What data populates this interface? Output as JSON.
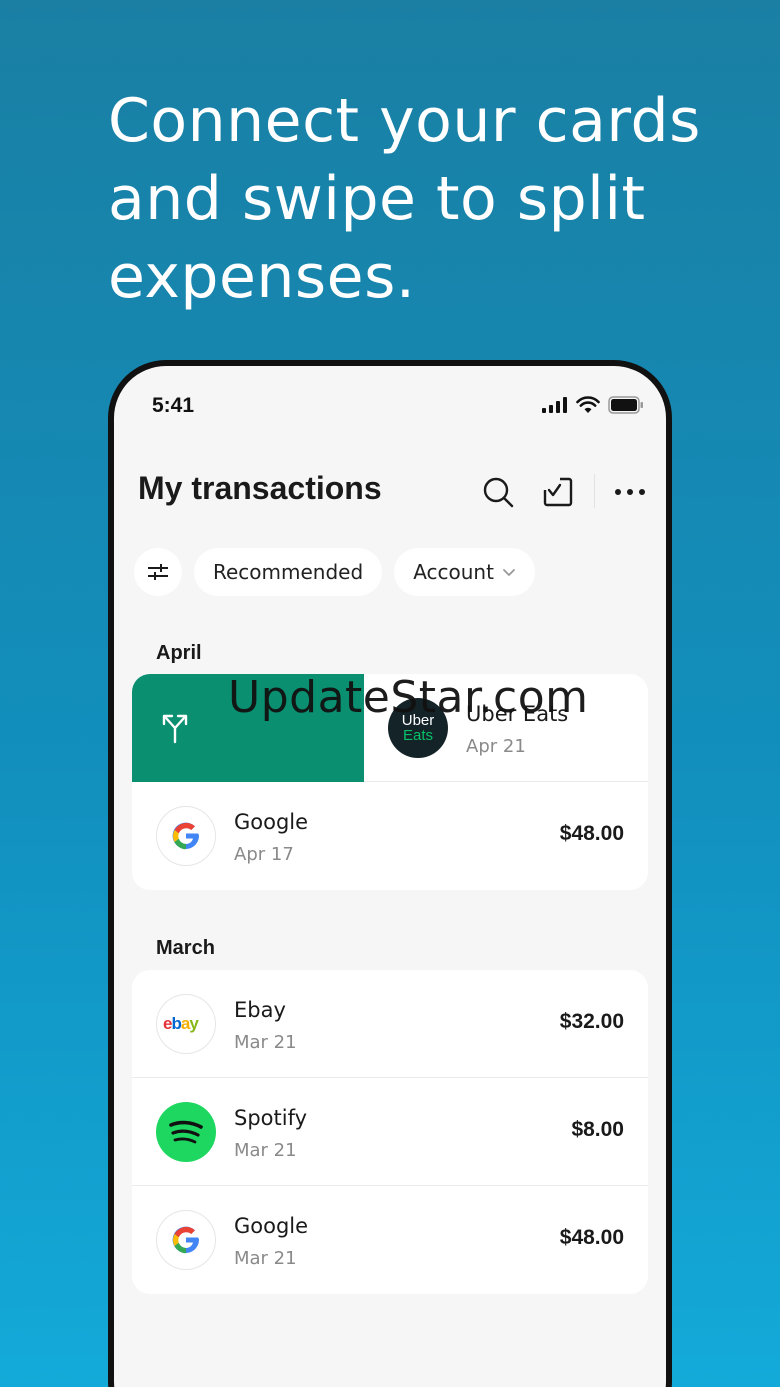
{
  "headline": {
    "line1": "Connect your cards",
    "line2": "and swipe to split",
    "line3": "expenses."
  },
  "status_bar": {
    "time": "5:41"
  },
  "header": {
    "title": "My transactions",
    "icons": [
      "search-icon",
      "check-square-icon",
      "more-icon"
    ]
  },
  "filters": {
    "recommended_label": "Recommended",
    "account_label": "Account"
  },
  "sections": [
    {
      "month": "April",
      "transactions": [
        {
          "merchant": "Uber Eats",
          "date": "Apr 21",
          "amount": "",
          "logo": "uber-eats-logo",
          "logo_text_1": "Uber",
          "logo_text_2": "Eats",
          "swiped": true
        },
        {
          "merchant": "Google",
          "date": "Apr 17",
          "amount": "$48.00",
          "logo": "google-logo"
        }
      ]
    },
    {
      "month": "March",
      "transactions": [
        {
          "merchant": "Ebay",
          "date": "Mar 21",
          "amount": "$32.00",
          "logo": "ebay-logo"
        },
        {
          "merchant": "Spotify",
          "date": "Mar 21",
          "amount": "$8.00",
          "logo": "spotify-logo"
        },
        {
          "merchant": "Google",
          "date": "Mar 21",
          "amount": "$48.00",
          "logo": "google-logo"
        }
      ]
    }
  ],
  "watermark": "UpdateStar.com",
  "colors": {
    "background_top": "#1a7fa3",
    "background_bottom": "#13aad9",
    "swipe_action": "#0a8f70",
    "spotify_green": "#1ed760"
  }
}
